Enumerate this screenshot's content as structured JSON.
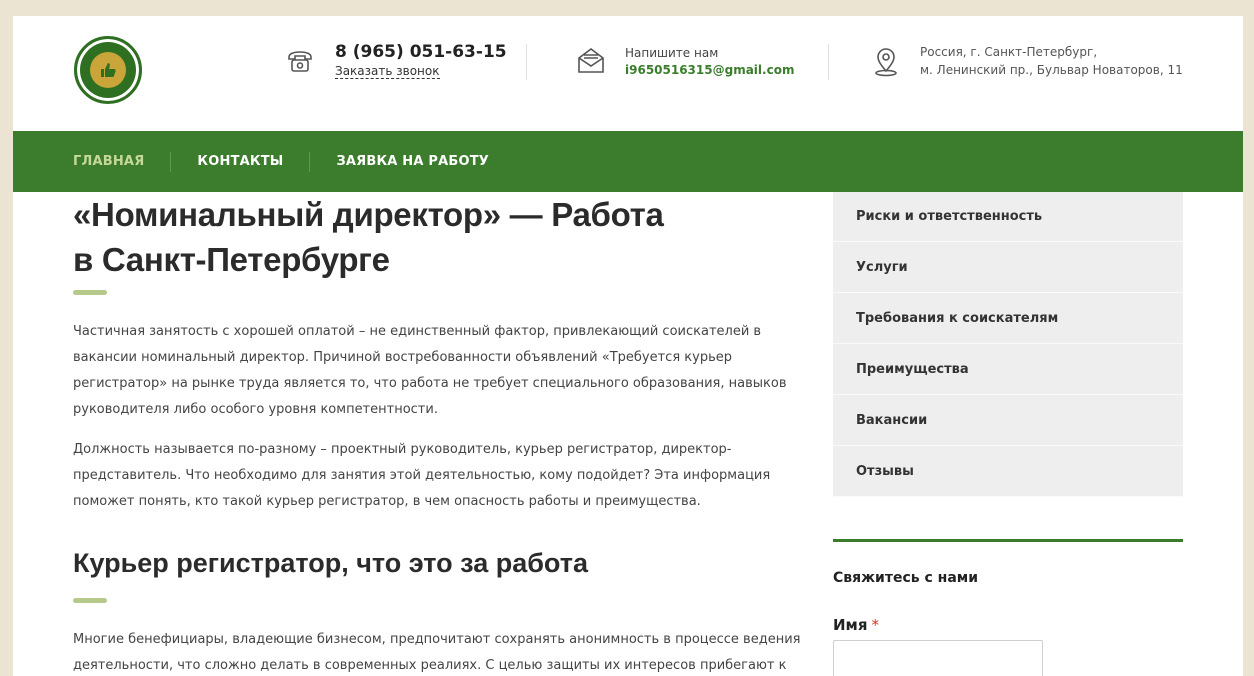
{
  "header": {
    "phone": "8 (965) 051-63-15",
    "call_link": "Заказать звонок",
    "mail_label": "Напишите нам",
    "email": "i9650516315@gmail.com",
    "address_line1": "Россия, г. Санкт-Петербург,",
    "address_line2": "м. Ленинский пр., Бульвар Новаторов, 11"
  },
  "nav": {
    "items": [
      {
        "label": "ГЛАВНАЯ"
      },
      {
        "label": "КОНТАКТЫ"
      },
      {
        "label": "ЗАЯВКА НА РАБОТУ"
      }
    ]
  },
  "main": {
    "title_line1": "«Номинальный директор» — Работа",
    "title_line2": "в Санкт-Петербурге",
    "p1": [
      "Частичная занятость с хорошей оплатой – не единственный фактор, привлекающий соискателей в",
      "вакансии номинальный директор. Причиной востребованности объявлений «Требуется курьер",
      "регистратор» на рынке труда является то, что работа не требует специального образования, навыков",
      "руководителя либо особого уровня компетентности."
    ],
    "p2": [
      "Должность называется по-разному – проектный руководитель, курьер регистратор, директор-",
      "представитель. Что необходимо для занятия этой деятельностью, кому подойдет? Эта информация",
      "поможет понять, кто такой курьер регистратор, в чем опасность работы и преимущества."
    ],
    "subtitle": "Курьер регистратор, что это за работа",
    "p3": [
      "Многие бенефициары, владеющие бизнесом, предпочитают сохранять анонимность в процессе ведения",
      "деятельности, что сложно делать в современных реалиях. С целью защиты их интересов прибегают к"
    ]
  },
  "sidebar": {
    "items": [
      {
        "label": "Риски и ответственность"
      },
      {
        "label": "Услуги"
      },
      {
        "label": "Требования к соискателям"
      },
      {
        "label": "Преимущества"
      },
      {
        "label": "Вакансии"
      },
      {
        "label": "Отзывы"
      }
    ],
    "contact_title": "Свяжитесь с нами",
    "name_label": "Имя",
    "required_mark": "*"
  },
  "colors": {
    "brand_green": "#3b7d2c",
    "nav_active": "#c6d79a",
    "accent_bar": "#b6c98a",
    "page_bg": "#ece4d2"
  }
}
